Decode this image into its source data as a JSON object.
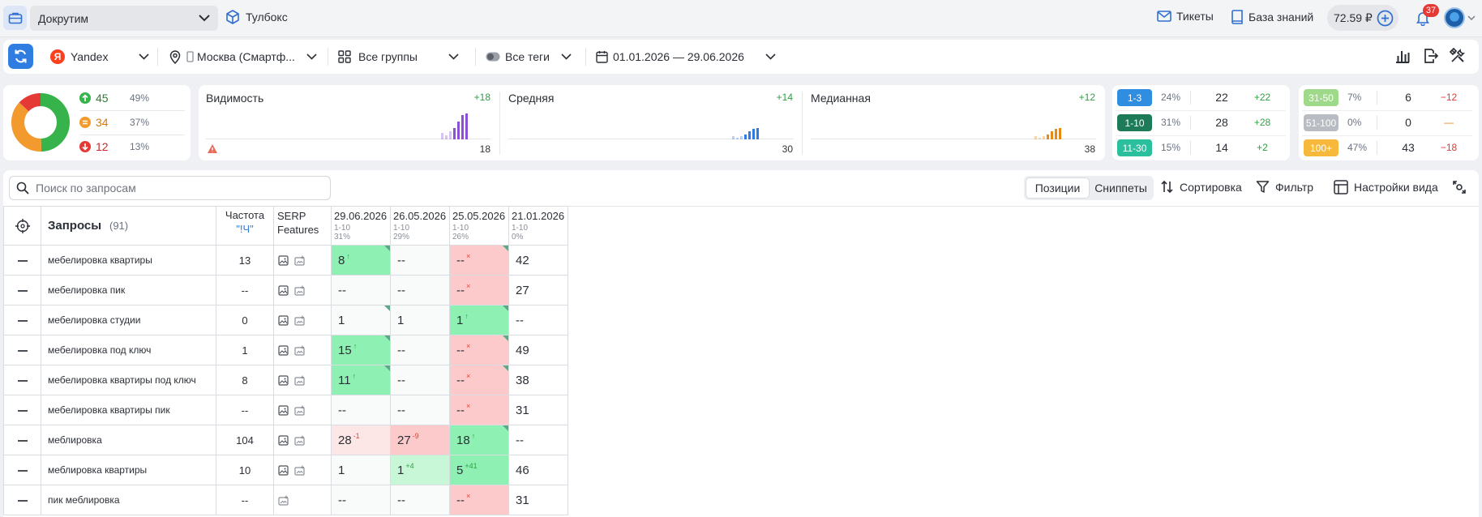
{
  "topbar": {
    "project": "Докрутим",
    "toolbox": "Тулбокс",
    "tickets": "Тикеты",
    "knowledge_base": "База знаний",
    "balance": "72.59 ₽",
    "notifications": "37"
  },
  "filters": {
    "engine": "Yandex",
    "region": "Москва (Смартф...",
    "groups": "Все группы",
    "tags": "Все теги",
    "dates": "01.01.2026 — 29.06.2026"
  },
  "distribution": {
    "colors": {
      "up": "#36b34a",
      "same": "#f29a2e",
      "down": "#e53935"
    },
    "rows": [
      {
        "count": "45",
        "pct": "49%",
        "icon": "arrow-up-circle-icon"
      },
      {
        "count": "34",
        "pct": "37%",
        "icon": "equal-circle-icon"
      },
      {
        "count": "12",
        "pct": "13%",
        "icon": "arrow-down-circle-icon"
      }
    ]
  },
  "metrics": [
    {
      "label": "Видимость",
      "delta": "+18",
      "value": "18",
      "color": "#8b4fd8",
      "warning": true
    },
    {
      "label": "Средняя",
      "delta": "+14",
      "value": "30",
      "color": "#2f7de1"
    },
    {
      "label": "Медианная",
      "delta": "+12",
      "value": "38",
      "color": "#e58a17"
    }
  ],
  "positions_left": [
    {
      "label": "1-3",
      "pct": "24%",
      "count": "22",
      "delta": "+22",
      "color": "#2f8ee0"
    },
    {
      "label": "1-10",
      "pct": "31%",
      "count": "28",
      "delta": "+28",
      "color": "#1e7b5a"
    },
    {
      "label": "11-30",
      "pct": "15%",
      "count": "14",
      "delta": "+2",
      "color": "#2bbf9e"
    }
  ],
  "positions_right": [
    {
      "label": "31-50",
      "pct": "7%",
      "count": "6",
      "delta": "−12",
      "color": "#9fd98a"
    },
    {
      "label": "51-100",
      "pct": "0%",
      "count": "0",
      "delta": "—",
      "color": "#b9bcc2"
    },
    {
      "label": "100+",
      "pct": "47%",
      "count": "43",
      "delta": "−18",
      "color": "#f6b93b"
    }
  ],
  "toolbar": {
    "search_placeholder": "Поиск по запросам",
    "view_positions": "Позиции",
    "view_snippets": "Сниппеты",
    "sort": "Сортировка",
    "filter": "Фильтр",
    "view_settings": "Настройки вида"
  },
  "table": {
    "col_queries": "Запросы",
    "queries_count": "(91)",
    "col_freq": "Частота",
    "col_freq_sub": "\"!Ч\"",
    "col_serp": "SERP Features",
    "dates": [
      {
        "date": "29.06.2026",
        "range": "1-10",
        "pct": "31%"
      },
      {
        "date": "26.05.2026",
        "range": "1-10",
        "pct": "29%"
      },
      {
        "date": "25.05.2026",
        "range": "1-10",
        "pct": "26%"
      },
      {
        "date": "21.01.2026",
        "range": "1-10",
        "pct": "0%"
      }
    ],
    "rows": [
      {
        "query": "мебелировка квартиры",
        "freq": "13",
        "serp": [
          "image-icon",
          "snippet-icon"
        ],
        "cells": [
          {
            "v": "8",
            "sup": "↑",
            "cls": "green",
            "sc": "up",
            "tri": true
          },
          {
            "v": "--",
            "cls": "pale"
          },
          {
            "v": "--",
            "sup": "×",
            "cls": "red",
            "sc": "x",
            "tri": true
          },
          {
            "v": "42",
            "cls": ""
          }
        ]
      },
      {
        "query": "мебелировка пик",
        "freq": "--",
        "serp": [
          "image-icon",
          "snippet-icon"
        ],
        "cells": [
          {
            "v": "--",
            "cls": "pale"
          },
          {
            "v": "--",
            "cls": "pale"
          },
          {
            "v": "--",
            "sup": "×",
            "cls": "red",
            "sc": "x"
          },
          {
            "v": "27",
            "cls": ""
          }
        ]
      },
      {
        "query": "мебелировка студии",
        "freq": "0",
        "serp": [
          "image-icon",
          "snippet-icon"
        ],
        "cells": [
          {
            "v": "1",
            "cls": "pale",
            "tri": true
          },
          {
            "v": "1",
            "cls": "pale"
          },
          {
            "v": "1",
            "sup": "↑",
            "cls": "green",
            "sc": "up",
            "tri": true
          },
          {
            "v": "--",
            "cls": ""
          }
        ]
      },
      {
        "query": "мебелировка под ключ",
        "freq": "1",
        "serp": [
          "image-icon",
          "snippet-icon"
        ],
        "cells": [
          {
            "v": "15",
            "sup": "↑",
            "cls": "green",
            "sc": "up",
            "tri": true
          },
          {
            "v": "--",
            "cls": "pale"
          },
          {
            "v": "--",
            "sup": "×",
            "cls": "red",
            "sc": "x",
            "tri": true
          },
          {
            "v": "49",
            "cls": ""
          }
        ]
      },
      {
        "query": "мебелировка квартиры под ключ",
        "freq": "8",
        "serp": [
          "image-icon",
          "snippet-icon"
        ],
        "cells": [
          {
            "v": "11",
            "sup": "↑",
            "cls": "green",
            "sc": "up",
            "tri": true
          },
          {
            "v": "--",
            "cls": "pale"
          },
          {
            "v": "--",
            "sup": "×",
            "cls": "red",
            "sc": "x",
            "tri": true
          },
          {
            "v": "38",
            "cls": ""
          }
        ]
      },
      {
        "query": "мебелировка квартиры пик",
        "freq": "--",
        "serp": [
          "image-icon",
          "snippet-icon"
        ],
        "cells": [
          {
            "v": "--",
            "cls": "pale"
          },
          {
            "v": "--",
            "cls": "pale"
          },
          {
            "v": "--",
            "sup": "×",
            "cls": "red",
            "sc": "x"
          },
          {
            "v": "31",
            "cls": ""
          }
        ]
      },
      {
        "query": "меблировка",
        "freq": "104",
        "serp": [
          "image-icon",
          "snippet-icon"
        ],
        "cells": [
          {
            "v": "28",
            "sup": "-1",
            "cls": "lred",
            "sc": "dn"
          },
          {
            "v": "27",
            "sup": "-9",
            "cls": "red",
            "sc": "dn"
          },
          {
            "v": "18",
            "sup": "↑",
            "cls": "green",
            "sc": "up",
            "tri": true
          },
          {
            "v": "--",
            "cls": ""
          }
        ]
      },
      {
        "query": "меблировка квартиры",
        "freq": "10",
        "serp": [
          "image-icon",
          "snippet-icon"
        ],
        "cells": [
          {
            "v": "1",
            "cls": "pale"
          },
          {
            "v": "1",
            "sup": "+4",
            "cls": "lgreen",
            "sc": "up"
          },
          {
            "v": "5",
            "sup": "+41",
            "cls": "green",
            "sc": "up"
          },
          {
            "v": "46",
            "cls": ""
          }
        ]
      },
      {
        "query": "пик меблировка",
        "freq": "--",
        "serp": [
          "snippet-icon"
        ],
        "cells": [
          {
            "v": "--",
            "cls": "pale"
          },
          {
            "v": "--",
            "cls": "pale"
          },
          {
            "v": "--",
            "sup": "×",
            "cls": "red",
            "sc": "x"
          },
          {
            "v": "31",
            "cls": ""
          }
        ]
      }
    ]
  }
}
